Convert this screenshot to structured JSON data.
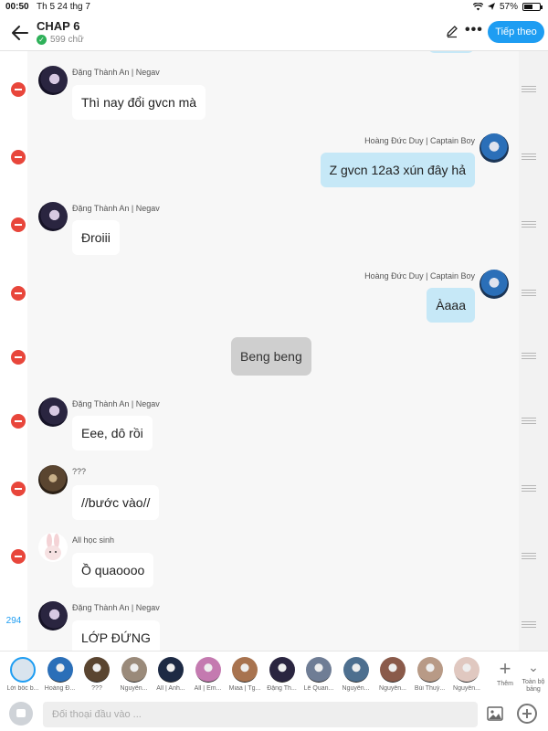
{
  "status_bar": {
    "time": "00:50",
    "date": "Th 5 24 thg 7",
    "battery": "57%",
    "battery_level": 0.57
  },
  "header": {
    "title": "CHAP 6",
    "word_count": "599 chữ",
    "follow_label": "Tiếp theo"
  },
  "messages": [
    {
      "side": "left",
      "speaker": "Đặng Thành An | Negav",
      "text": "Thì nay đổi gvcn mà",
      "avatar": "dark"
    },
    {
      "side": "right",
      "speaker": "Hoàng Đức Duy | Captain Boy",
      "text": "Z gvcn 12a3 xún đây hả",
      "avatar": "blue"
    },
    {
      "side": "left",
      "speaker": "Đặng Thành An | Negav",
      "text": "Đroiii",
      "avatar": "dark"
    },
    {
      "side": "right",
      "speaker": "Hoàng Đức Duy | Captain Boy",
      "text": "Àaaa",
      "avatar": "blue"
    },
    {
      "side": "center",
      "speaker": "",
      "text": "Beng beng",
      "avatar": ""
    },
    {
      "side": "left",
      "speaker": "Đặng Thành An | Negav",
      "text": "Eee, dô rồi",
      "avatar": "dark"
    },
    {
      "side": "left",
      "speaker": "???",
      "text": "//bước vào//",
      "avatar": "brown"
    },
    {
      "side": "left",
      "speaker": "All học sinh",
      "text": "Ồ quaoooo",
      "avatar": "bunny"
    },
    {
      "side": "left",
      "speaker": "Đặng Thành An | Negav",
      "text": "LỚP ĐỨNG",
      "avatar": "dark"
    }
  ],
  "counter": "294",
  "characters": [
    {
      "label": "Lời bốc b...",
      "color": "#d9e4ee"
    },
    {
      "label": "Hoàng Đ...",
      "color": "#2b6fb8"
    },
    {
      "label": "???",
      "color": "#5a4530"
    },
    {
      "label": "Nguyễn...",
      "color": "#9a8a7a"
    },
    {
      "label": "All | Anh...",
      "color": "#1d2a44"
    },
    {
      "label": "All | Em...",
      "color": "#c47ab0"
    },
    {
      "label": "Miaa | Tg...",
      "color": "#a8734f"
    },
    {
      "label": "Đặng Th...",
      "color": "#2a2540"
    },
    {
      "label": "Lê Quan...",
      "color": "#6f7d95"
    },
    {
      "label": "Nguyễn...",
      "color": "#4d6f8f"
    },
    {
      "label": "Nguyễn...",
      "color": "#8a5a4a"
    },
    {
      "label": "Bùi Thuỳ...",
      "color": "#b89a86"
    },
    {
      "label": "Nguyễn...",
      "color": "#e0c8c0"
    }
  ],
  "add_label": "Thêm",
  "all_label": "Toàn bộ bảng",
  "input": {
    "placeholder": "Đối thoại đầu vào ..."
  },
  "colors": {
    "accent": "#1e9df2",
    "delete": "#e8463b",
    "right_bubble": "#c6e8f7"
  }
}
